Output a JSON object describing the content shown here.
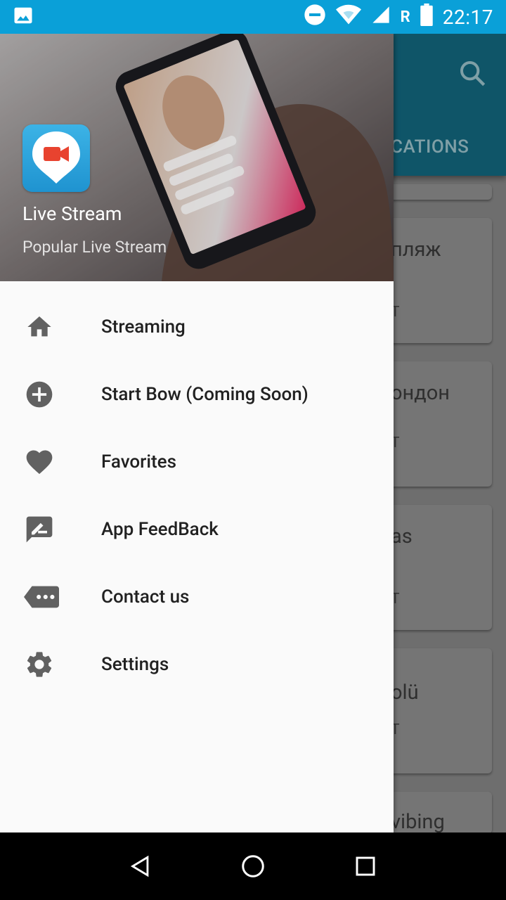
{
  "status_bar": {
    "time": "22:17",
    "carrier_letter": "R"
  },
  "background_app": {
    "tab_label_fragment": "CATIONS",
    "cards": [
      {
        "title": "пляж",
        "sub": "T"
      },
      {
        "title": "ондон",
        "sub": "T"
      },
      {
        "title": "as",
        "sub": "T"
      },
      {
        "title": "olü",
        "sub": "T"
      },
      {
        "title": "vibing",
        "sub": ""
      }
    ]
  },
  "drawer": {
    "header": {
      "app_name": "Live Stream",
      "app_tagline": "Popular Live Stream",
      "logo_icon": "video-camera-pin-icon"
    },
    "menu": [
      {
        "label": "Streaming",
        "icon": "home-icon"
      },
      {
        "label": "Start Bow (Coming Soon)",
        "icon": "add-circle-icon"
      },
      {
        "label": "Favorites",
        "icon": "heart-icon"
      },
      {
        "label": "App FeedBack",
        "icon": "feedback-icon"
      },
      {
        "label": "Contact us",
        "icon": "more-message-icon"
      },
      {
        "label": "Settings",
        "icon": "gear-icon"
      }
    ]
  },
  "colors": {
    "status_bar": "#0aa0d8",
    "app_bar": "#0f5568",
    "icon_gray": "#616161",
    "logo_blue": "#2aa3dd",
    "logo_red": "#e8432f"
  }
}
